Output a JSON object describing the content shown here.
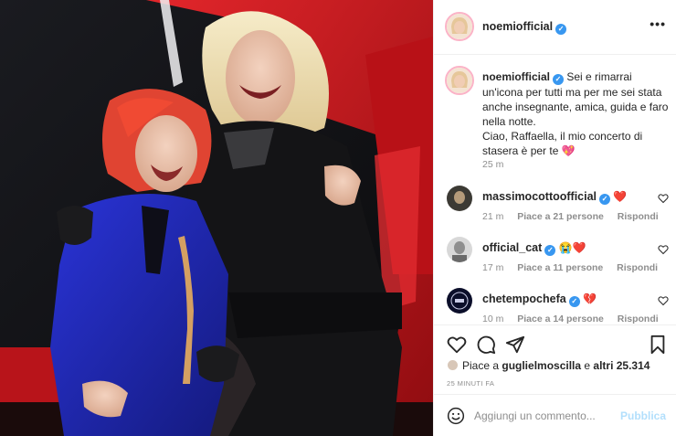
{
  "post": {
    "image_alt": "",
    "author": "noemiofficial",
    "verified_mark": "✓"
  },
  "header": {
    "username": "noemiofficial",
    "more_label": "•••"
  },
  "caption": {
    "username": "noemiofficial",
    "text": "Sei e rimarrai un'icona per tutti ma per me sei stata anche insegnante, amica, guida e faro nella notte.\nCiao, Raffaella, il mio concerto di stasera è per te",
    "emoji": "💖",
    "time": "25 m"
  },
  "comments": [
    {
      "username": "massimocottoofficial",
      "text": "❤️",
      "time": "21 m",
      "likes": "Piace a 21 persone",
      "reply": "Rispondi"
    },
    {
      "username": "official_cat",
      "text": "😭❤️",
      "time": "17 m",
      "likes": "Piace a 11 persone",
      "reply": "Rispondi"
    },
    {
      "username": "chetempochefa",
      "text": "💔",
      "time": "10 m",
      "likes": "Piace a 14 persone",
      "reply": "Rispondi"
    }
  ],
  "likes": {
    "prefix": "Piace a ",
    "user": "guglielmoscilla",
    "middle": " e ",
    "others": "altri 25.314"
  },
  "post_time": "25 MINUTI FA",
  "add_comment": {
    "placeholder": "Aggiungi un commento...",
    "publish_label": "Pubblica"
  },
  "colors": {
    "verified": "#3897f0",
    "heart": "#ed4956",
    "publish_disabled": "#b2dffc",
    "chair_red": "#c8161d"
  },
  "icons": [
    "heart-icon",
    "comment-icon",
    "share-icon",
    "bookmark-icon",
    "emoji-icon",
    "more-icon",
    "verified-icon"
  ]
}
